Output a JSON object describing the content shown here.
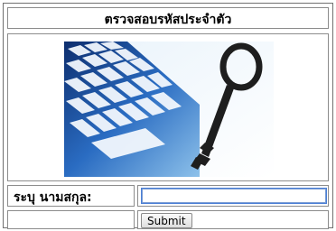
{
  "header": {
    "title": "ตรวจสอบรหัสประจำตัว"
  },
  "image": {
    "icon": "keyboard-key-icon"
  },
  "form": {
    "name_label": "ระบุ นามสกุล:",
    "name_value": "",
    "submit_label": "Submit"
  }
}
